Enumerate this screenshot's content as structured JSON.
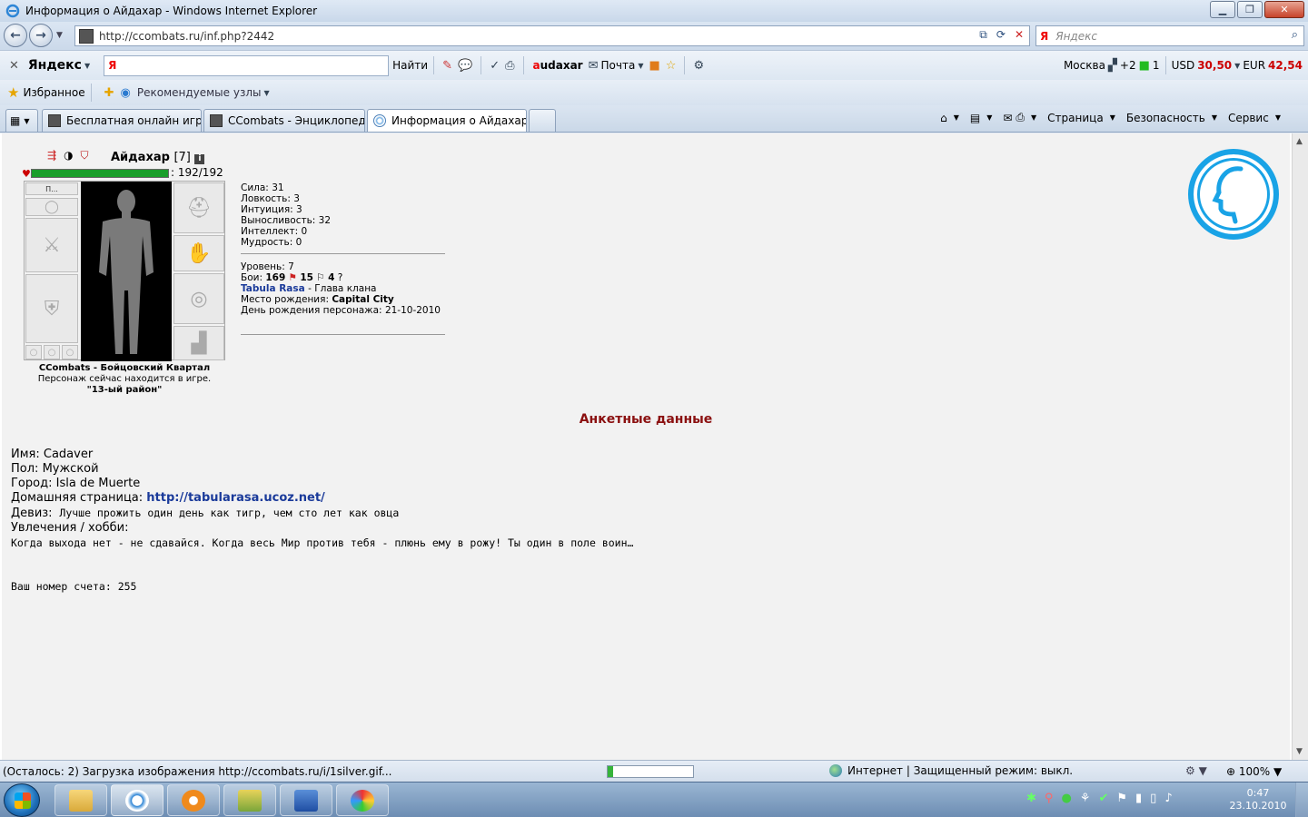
{
  "window": {
    "title": "Информация о Айдахар - Windows Internet Explorer",
    "minimize": "▁",
    "maximize": "❐",
    "close": "✕"
  },
  "address": {
    "url": "http://ccombats.ru/inf.php?2442",
    "search_placeholder": "Яндекс"
  },
  "yandex_toolbar": {
    "brand": "Яндекс",
    "find_label": "Найти",
    "user_prefix": "a",
    "user_rest": "udaxar",
    "mail_label": "Почта",
    "city": "Москва",
    "weather": "+2",
    "counter": "1",
    "usd_label": "USD",
    "usd_value": "30,50",
    "eur_label": "EUR",
    "eur_value": "42,54"
  },
  "favorites": {
    "favorites_label": "Избранное",
    "suggested_label": "Рекомендуемые узлы"
  },
  "tabs": [
    {
      "label": "Бесплатная онлайн игра ..."
    },
    {
      "label": "CCombats - Энциклопеди..."
    },
    {
      "label": "Информация о Айдахар"
    }
  ],
  "command_bar": {
    "page": "Страница",
    "security": "Безопасность",
    "service": "Сервис"
  },
  "character": {
    "nick": "Айдахар",
    "level_badge": "[7]",
    "hp": "192/192",
    "hp_fraction": 1.0,
    "place_title": "CCombats - Бойцовский Квартал",
    "place_status": "Персонаж сейчас находится в игре.",
    "place_room": "\"13-ый район\"",
    "slot_label": "П...",
    "stats": [
      {
        "label": "Сила:",
        "value": "31"
      },
      {
        "label": "Ловкость:",
        "value": "3"
      },
      {
        "label": "Интуиция:",
        "value": "3"
      },
      {
        "label": "Выносливость:",
        "value": "32"
      },
      {
        "label": "Интеллект:",
        "value": "0"
      },
      {
        "label": "Мудрость:",
        "value": "0"
      }
    ],
    "level_label": "Уровень:",
    "level_value": "7",
    "fights_label": "Бои:",
    "fights_total": "169",
    "fights_wins": "15",
    "fights_draws": "4",
    "fights_help": "?",
    "clan_name": "Tabula Rasa",
    "clan_role": " - Глава клана",
    "birthplace_label": "Место рождения:",
    "birthplace_value": "Capital City",
    "birthday_label": "День рождения персонажа:",
    "birthday_value": "21-10-2010"
  },
  "profile": {
    "title": "Анкетные данные",
    "name_label": "Имя:",
    "name_value": "Cadaver",
    "gender_label": "Пол:",
    "gender_value": "Мужской",
    "city_label": "Город:",
    "city_value": "Isla de Muerte",
    "homepage_label": "Домашняя страница:",
    "homepage_value": "http://tabularasa.ucoz.net/",
    "motto_label": "Девиз:",
    "motto_value": "Лучше прожить один день как тигр, чем сто лет как овца",
    "hobby_label": "Увлечения / хобби:",
    "hobby_value": "Когда выхода нет - не сдавайся. Когда весь Мир против тебя - плюнь ему в рожу! Ты один в поле воин…",
    "account": "Ваш номер счета: 255"
  },
  "status": {
    "message": "(Осталось: 2) Загрузка изображения http://ccombats.ru/i/1silver.gif...",
    "progress": 0.06,
    "zone": "Интернет | Защищенный режим: выкл.",
    "zoom": "100%"
  },
  "taskbar": {
    "time": "0:47",
    "date": "23.10.2010"
  }
}
